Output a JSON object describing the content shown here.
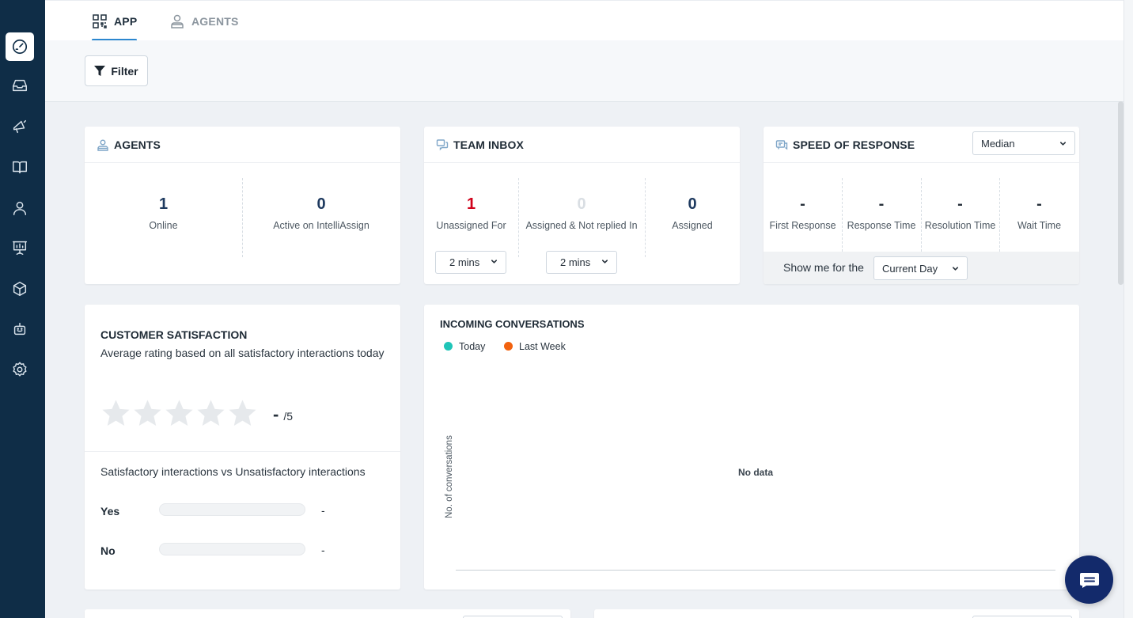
{
  "sidebar": {
    "items": [
      {
        "icon": "dashboard-icon",
        "active": true
      },
      {
        "icon": "inbox-icon",
        "active": false
      },
      {
        "icon": "campaigns-icon",
        "active": false
      },
      {
        "icon": "book-icon",
        "active": false
      },
      {
        "icon": "contacts-icon",
        "active": false
      },
      {
        "icon": "reports-icon",
        "active": false
      },
      {
        "icon": "box-icon",
        "active": false
      },
      {
        "icon": "bot-icon",
        "active": false
      },
      {
        "icon": "settings-icon",
        "active": false
      }
    ]
  },
  "tabs": {
    "app": "APP",
    "agents": "AGENTS",
    "active": "APP"
  },
  "filter": {
    "label": "Filter"
  },
  "agents_card": {
    "title": "AGENTS",
    "online_value": "1",
    "online_label": "Online",
    "active_value": "0",
    "active_label": "Active on IntelliAssign"
  },
  "team_inbox": {
    "title": "TEAM INBOX",
    "unassigned_value": "1",
    "unassigned_label": "Unassigned For",
    "unassigned_select": "2 mins",
    "not_replied_value": "0",
    "not_replied_label": "Assigned & Not replied In",
    "not_replied_select": "2 mins",
    "assigned_value": "0",
    "assigned_label": "Assigned",
    "colors": {
      "unassigned": "#d0021b",
      "not_replied": "#d9dee3",
      "assigned": "#1e3a5f"
    }
  },
  "speed": {
    "title": "SPEED OF RESPONSE",
    "select": "Median",
    "metrics": [
      {
        "value": "-",
        "label": "First Response"
      },
      {
        "value": "-",
        "label": "Response Time"
      },
      {
        "value": "-",
        "label": "Resolution Time"
      },
      {
        "value": "-",
        "label": "Wait Time"
      }
    ],
    "show_me_label": "Show me for the",
    "period": "Current Day"
  },
  "csat": {
    "title": "CUSTOMER SATISFACTION",
    "subtitle": "Average rating based on all satisfactory interactions today",
    "rating": "-",
    "rating_max": "/5",
    "stars_filled": 0,
    "stars_total": 5,
    "compare_title": "Satisfactory interactions vs Unsatisfactory interactions",
    "yes_label": "Yes",
    "yes_value": "-",
    "no_label": "No",
    "no_value": "-"
  },
  "incoming": {
    "title": "INCOMING CONVERSATIONS",
    "legend": [
      {
        "name": "Today",
        "color": "#1fc5b8"
      },
      {
        "name": "Last Week",
        "color": "#f2620f"
      }
    ],
    "ylabel": "No. of conversations",
    "empty_text": "No data"
  },
  "chart_data": {
    "type": "line",
    "title": "INCOMING CONVERSATIONS",
    "ylabel": "No. of conversations",
    "series": [
      {
        "name": "Today",
        "values": []
      },
      {
        "name": "Last Week",
        "values": []
      }
    ],
    "legend": "top-left",
    "annotation": "No data"
  },
  "chat_widget": {
    "icon": "chat-icon"
  }
}
